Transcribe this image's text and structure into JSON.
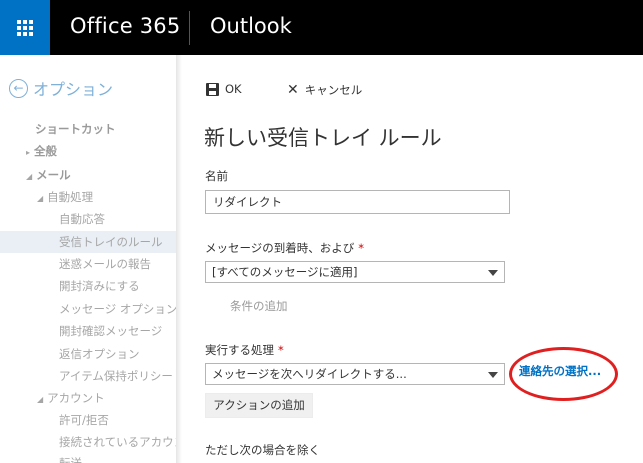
{
  "header": {
    "brand": "Office 365",
    "app_name": "Outlook"
  },
  "sidebar": {
    "back_label": "オプション",
    "items": [
      {
        "label": "ショートカット"
      },
      {
        "label": "全般"
      },
      {
        "label": "メール"
      },
      {
        "label": "自動処理"
      },
      {
        "label": "自動応答"
      },
      {
        "label": "受信トレイのルール"
      },
      {
        "label": "迷惑メールの報告"
      },
      {
        "label": "開封済みにする"
      },
      {
        "label": "メッセージ オプション"
      },
      {
        "label": "開封確認メッセージ"
      },
      {
        "label": "返信オプション"
      },
      {
        "label": "アイテム保持ポリシー"
      },
      {
        "label": "アカウント"
      },
      {
        "label": "許可/拒否"
      },
      {
        "label": "接続されているアカウント"
      },
      {
        "label": "転送"
      }
    ]
  },
  "toolbar": {
    "ok_label": "OK",
    "cancel_label": "キャンセル"
  },
  "form": {
    "title": "新しい受信トレイ ルール",
    "name_label": "名前",
    "name_value": "リダイレクト",
    "condition_label": "メッセージの到着時、および",
    "condition_value": "[すべてのメッセージに適用]",
    "add_condition": "条件の追加",
    "action_label": "実行する処理",
    "action_value": "メッセージを次へリダイレクトする...",
    "select_contacts": "連絡先の選択...",
    "add_action": "アクションの追加",
    "exception_label": "ただし次の場合を除く",
    "required_mark": "*"
  },
  "colors": {
    "accent": "#0072c6",
    "topbar": "#000000",
    "highlight_oval": "#e02020"
  }
}
